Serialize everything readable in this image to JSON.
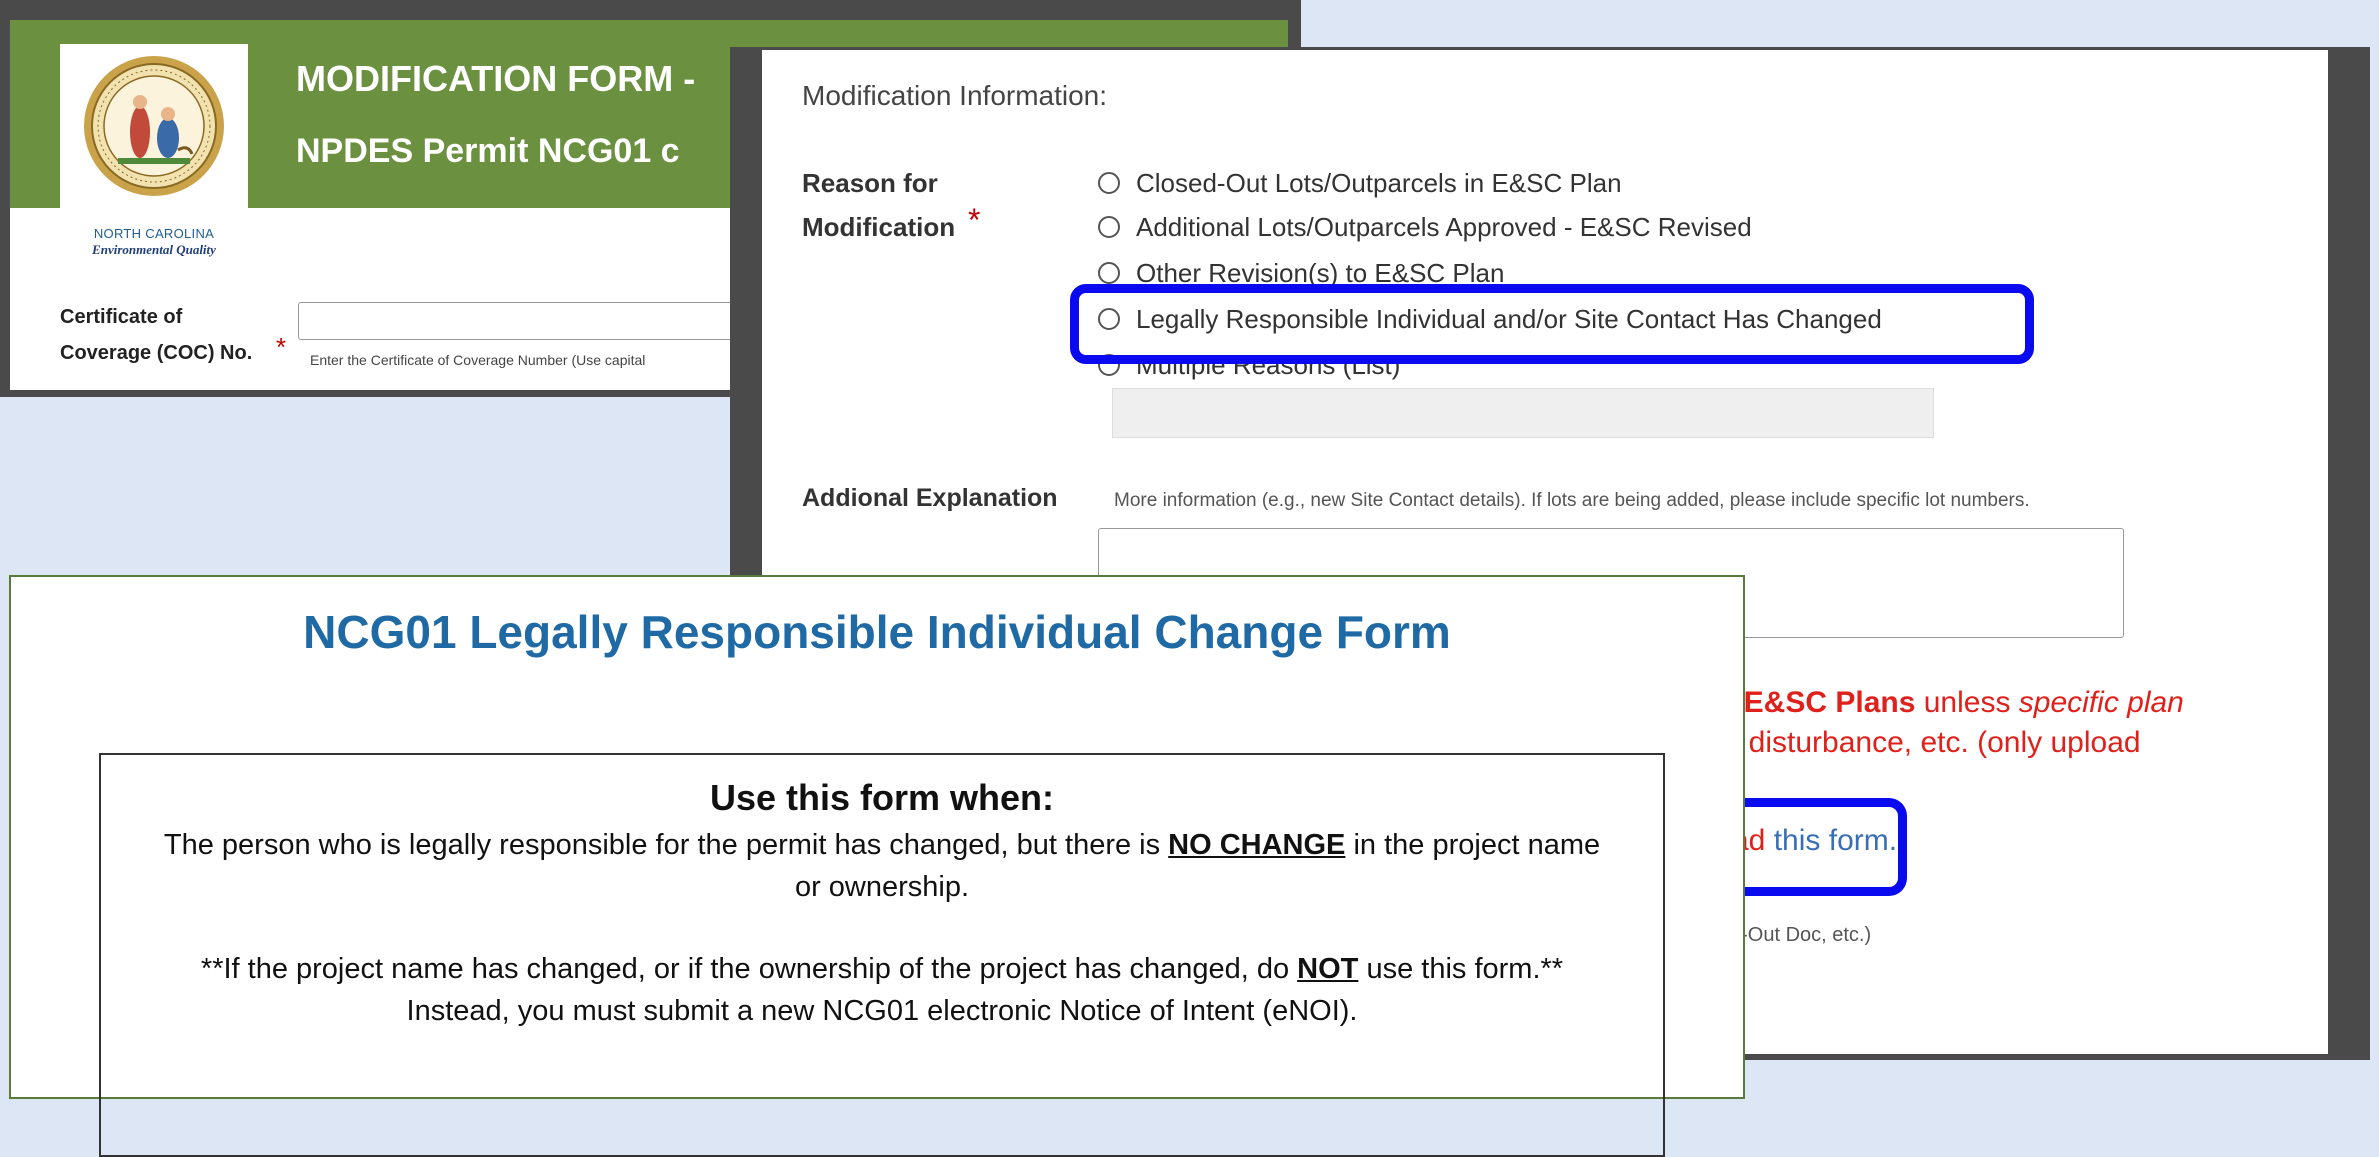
{
  "panel1": {
    "title_line1": "MODIFICATION FORM -",
    "title_line2": "NPDES Permit NCG01 c",
    "logo": {
      "line1": "NORTH CAROLINA",
      "line2": "Environmental Quality"
    },
    "coc": {
      "label_line1": "Certificate of",
      "label_line2": "Coverage (COC) No.",
      "required_mark": "*",
      "help": "Enter the Certificate of Coverage Number (Use capital"
    }
  },
  "panel2": {
    "section_title": "Modification Information:",
    "reason_label_line1": "Reason for",
    "reason_label_line2": "Modification",
    "required_mark": "*",
    "options": [
      "Closed-Out Lots/Outparcels in E&SC Plan",
      "Additional Lots/Outparcels Approved - E&SC Revised",
      "Other Revision(s) to E&SC Plan",
      "Legally Responsible Individual and/or Site Contact Has Changed",
      "Multiple Reasons (List)"
    ],
    "additional_label": "Addional Explanation",
    "additional_help": "More information (e.g., new Site Contact details). If lots are being added, please include specific lot numbers.",
    "red_text": {
      "line1_bold": "d E&SC Plans",
      "line1_mid": " unless ",
      "line1_italic": "specific plan",
      "line2": "f disturbance, etc. (only upload"
    },
    "link_prefix": "ad ",
    "link_text": "this form.",
    "upload_help": "e-Out Doc, etc.)"
  },
  "panel3": {
    "title": "NCG01 Legally Responsible Individual Change Form",
    "use_heading": "Use this form when:",
    "line1_a": "The person who is legally responsible for the permit has changed, but there is ",
    "line1_b": "NO CHANGE",
    "line1_c": " in the project name",
    "line2": "or ownership.",
    "note1_a": "**If the project name has changed, or if the ownership of the project has changed, do ",
    "note1_b": "NOT",
    "note1_c": " use this form.**",
    "note2": "Instead, you must submit a new NCG01 electronic Notice of Intent (eNOI)."
  },
  "colors": {
    "header_green": "#6b9140",
    "highlight_blue": "#0a0af0",
    "required_red": "#c00000",
    "title_blue": "#1f6aa5",
    "link_blue": "#3a6fb5"
  },
  "icons": [
    "nc-state-seal-icon",
    "radio-button-icon"
  ]
}
